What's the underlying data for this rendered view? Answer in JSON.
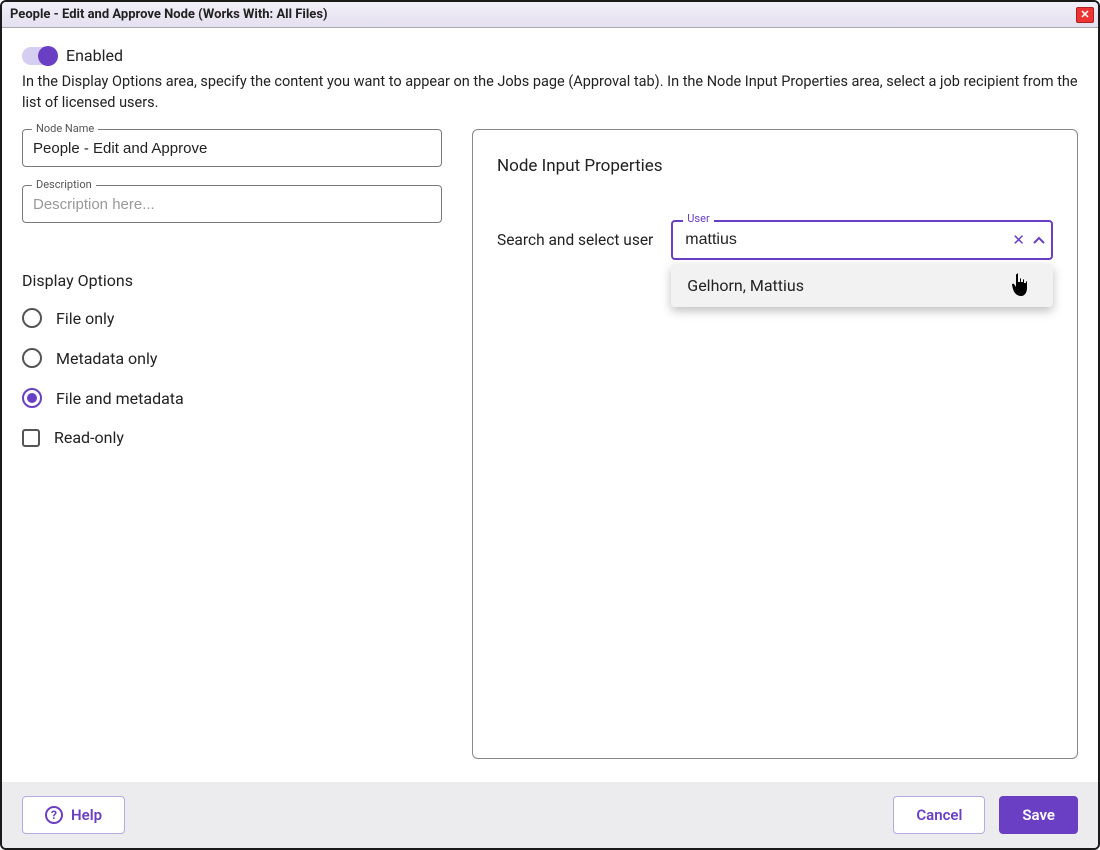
{
  "title": "People - Edit and Approve Node (Works With: All Files)",
  "enabled_label": "Enabled",
  "intro_text": "In the Display Options area, specify the content you want to appear on the Jobs page (Approval tab). In the Node Input Properties area, select a job recipient from the list of licensed users.",
  "left": {
    "node_name_label": "Node Name",
    "node_name_value": "People - Edit and Approve",
    "description_label": "Description",
    "description_placeholder": "Description here...",
    "display_options_title": "Display Options",
    "options": {
      "file_only": "File only",
      "metadata_only": "Metadata only",
      "file_and_metadata": "File and metadata",
      "read_only": "Read-only"
    },
    "selected_option": "file_and_metadata",
    "read_only_checked": false
  },
  "right": {
    "panel_title": "Node Input Properties",
    "search_label": "Search and select user",
    "user_field_label": "User",
    "user_search_value": "mattius",
    "dropdown_items": [
      "Gelhorn, Mattius"
    ]
  },
  "footer": {
    "help": "Help",
    "cancel": "Cancel",
    "save": "Save"
  }
}
